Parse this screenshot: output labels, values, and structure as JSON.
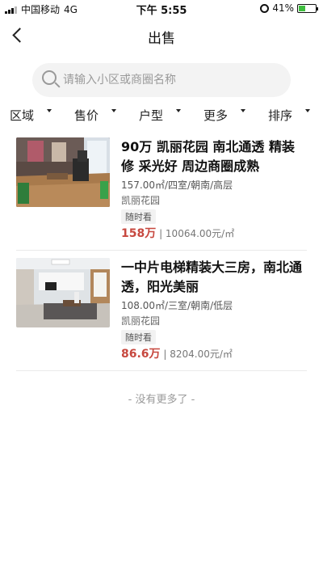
{
  "status_bar": {
    "carrier": "中国移动",
    "network": "4G",
    "time": "下午 5:55",
    "battery": "41%",
    "battery_level": 0.41
  },
  "nav": {
    "title": "出售"
  },
  "search": {
    "placeholder": "请输入小区或商圈名称"
  },
  "filters": [
    "区域",
    "售价",
    "户型",
    "更多",
    "排序"
  ],
  "listings": [
    {
      "title": "90万 凯丽花园 南北通透 精装修 采光好 周边商圈成熟",
      "meta": "157.00㎡/四室/朝南/高层",
      "community": "凯丽花园",
      "tag": "随时看",
      "price": "158万",
      "unit_price": "| 10064.00元/㎡"
    },
    {
      "title": "一中片电梯精装大三房，南北通透，阳光美丽",
      "meta": "108.00㎡/三室/朝南/低层",
      "community": "凯丽花园",
      "tag": "随时看",
      "price": "86.6万",
      "unit_price": "| 8204.00元/㎡"
    }
  ],
  "footer": {
    "no_more": "- 没有更多了 -"
  }
}
